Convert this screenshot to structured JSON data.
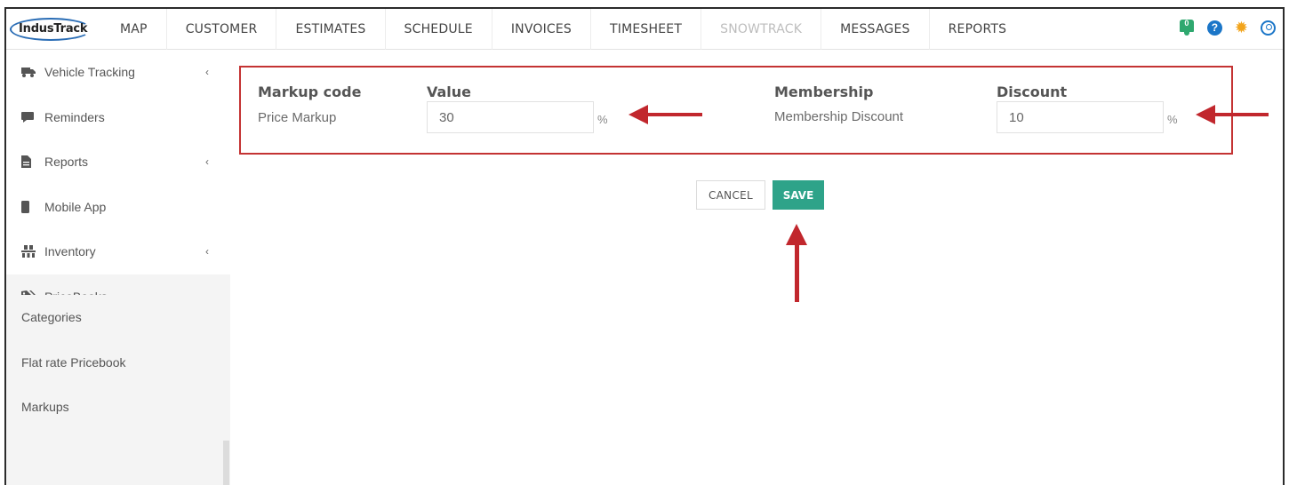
{
  "app": {
    "logo_text": "IndusTrack"
  },
  "nav": {
    "items": [
      {
        "label": "MAP"
      },
      {
        "label": "CUSTOMER"
      },
      {
        "label": "ESTIMATES"
      },
      {
        "label": "SCHEDULE"
      },
      {
        "label": "INVOICES"
      },
      {
        "label": "TIMESHEET"
      },
      {
        "label": "SNOWTRACK",
        "disabled": true
      },
      {
        "label": "MESSAGES"
      },
      {
        "label": "REPORTS"
      }
    ],
    "notification_count": "0",
    "help_glyph": "?",
    "icons": [
      "notification-bell-icon",
      "help-icon",
      "settings-gear-icon",
      "user-account-icon"
    ]
  },
  "sidebar": {
    "items": [
      {
        "label": "Vehicle Tracking",
        "icon": "truck-icon",
        "expandable": true
      },
      {
        "label": "Reminders",
        "icon": "comment-icon",
        "expandable": false
      },
      {
        "label": "Reports",
        "icon": "file-icon",
        "expandable": true
      },
      {
        "label": "Mobile App",
        "icon": "mobile-icon",
        "expandable": false
      },
      {
        "label": "Inventory",
        "icon": "warehouse-icon",
        "expandable": true
      },
      {
        "label": "PriceBooks",
        "icon": "tags-icon",
        "expandable": true,
        "expanded": true
      }
    ],
    "subitems": [
      {
        "label": "Categories"
      },
      {
        "label": "Flat rate Pricebook"
      },
      {
        "label": "Markups"
      }
    ]
  },
  "markup_form": {
    "markup_code_label": "Markup code",
    "markup_code_value": "Price Markup",
    "value_label": "Value",
    "value": "30",
    "value_unit": "%",
    "membership_label": "Membership",
    "membership_value": "Membership Discount",
    "discount_label": "Discount",
    "discount": "10",
    "discount_unit": "%"
  },
  "actions": {
    "cancel_label": "CANCEL",
    "save_label": "SAVE"
  },
  "colors": {
    "annotation_red": "#c1272d",
    "save_green": "#2ea389",
    "brand_blue": "#1b76c8",
    "gear_orange": "#f2a41b",
    "bell_green": "#2fa86f"
  }
}
